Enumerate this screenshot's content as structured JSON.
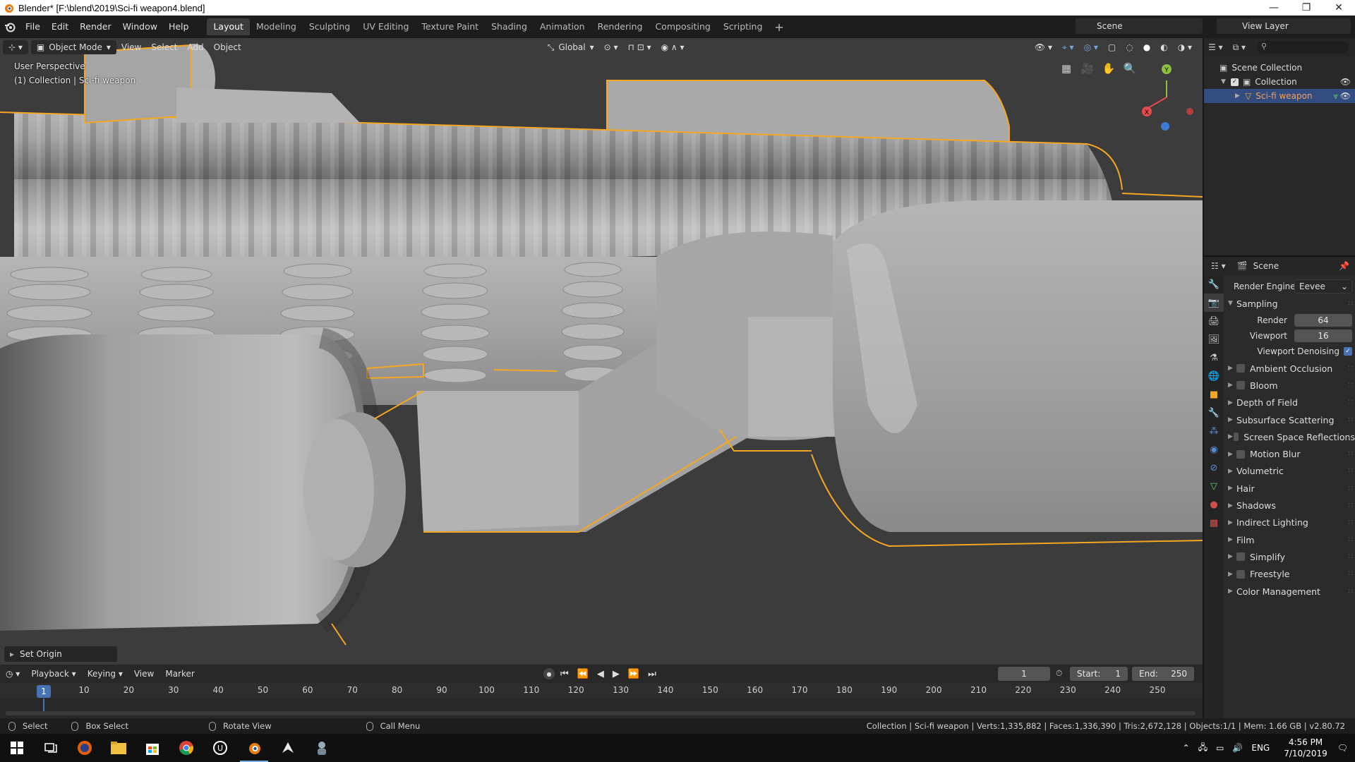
{
  "window": {
    "title": "Blender* [F:\\blend\\2019\\Sci-fi weapon4.blend]",
    "minimize": "—",
    "maximize": "❐",
    "close": "✕"
  },
  "menu": {
    "file": "File",
    "edit": "Edit",
    "render": "Render",
    "window": "Window",
    "help": "Help"
  },
  "workspaces": [
    "Layout",
    "Modeling",
    "Sculpting",
    "UV Editing",
    "Texture Paint",
    "Shading",
    "Animation",
    "Rendering",
    "Compositing",
    "Scripting"
  ],
  "plus": "+",
  "scene_selector": "Scene",
  "view_layer_selector": "View Layer",
  "viewport": {
    "mode": "Object Mode",
    "menus": {
      "view": "View",
      "select": "Select",
      "add": "Add",
      "object": "Object"
    },
    "transform_orientation": "Global",
    "info_line1": "User Perspective",
    "info_line2": "(1) Collection | Sci-fi weapon",
    "operator_panel": "Set Origin",
    "gizmo": {
      "x": "X",
      "y": "Y",
      "z": "Z"
    }
  },
  "outliner": {
    "rows": [
      {
        "label": "Scene Collection"
      },
      {
        "label": "Collection"
      },
      {
        "label": "Sci-fi weapon"
      }
    ]
  },
  "properties": {
    "header": "Scene",
    "render_engine_label": "Render Engine",
    "render_engine_value": "Eevee",
    "sampling": {
      "title": "Sampling",
      "render_label": "Render",
      "render_value": "64",
      "viewport_label": "Viewport",
      "viewport_value": "16",
      "denoise_label": "Viewport Denoising",
      "denoise_checked": true
    },
    "panels": [
      {
        "label": "Ambient Occlusion",
        "checkbox": true
      },
      {
        "label": "Bloom",
        "checkbox": true
      },
      {
        "label": "Depth of Field",
        "checkbox": false
      },
      {
        "label": "Subsurface Scattering",
        "checkbox": false
      },
      {
        "label": "Screen Space Reflections",
        "checkbox": true
      },
      {
        "label": "Motion Blur",
        "checkbox": true
      },
      {
        "label": "Volumetric",
        "checkbox": false
      },
      {
        "label": "Hair",
        "checkbox": false
      },
      {
        "label": "Shadows",
        "checkbox": false
      },
      {
        "label": "Indirect Lighting",
        "checkbox": false
      },
      {
        "label": "Film",
        "checkbox": false
      },
      {
        "label": "Simplify",
        "checkbox": true
      },
      {
        "label": "Freestyle",
        "checkbox": true
      },
      {
        "label": "Color Management",
        "checkbox": false
      }
    ]
  },
  "timeline": {
    "menus": {
      "playback": "Playback",
      "keying": "Keying",
      "view": "View",
      "marker": "Marker"
    },
    "current_frame": "1",
    "start_label": "Start:",
    "start_value": "1",
    "end_label": "End:",
    "end_value": "250",
    "ruler_cursor": "1",
    "ticks": [
      "10",
      "20",
      "30",
      "40",
      "50",
      "60",
      "70",
      "80",
      "90",
      "100",
      "110",
      "120",
      "130",
      "140",
      "150",
      "160",
      "170",
      "180",
      "190",
      "200",
      "210",
      "220",
      "230",
      "240",
      "250"
    ]
  },
  "statusbar": {
    "select": "Select",
    "box_select": "Box Select",
    "rotate_view": "Rotate View",
    "call_menu": "Call Menu",
    "stats": "Collection | Sci-fi weapon | Verts:1,335,882 | Faces:1,336,390 | Tris:2,672,128 | Objects:1/1 | Mem: 1.66 GB | v2.80.72"
  },
  "taskbar": {
    "lang": "ENG",
    "time": "4:56 PM",
    "date": "7/10/2019"
  },
  "colors": {
    "accent": "#4772b3",
    "selection_outline": "#f5a623",
    "viewport_bg": "#3c3c3c",
    "mesh": "#a8a8a8"
  }
}
